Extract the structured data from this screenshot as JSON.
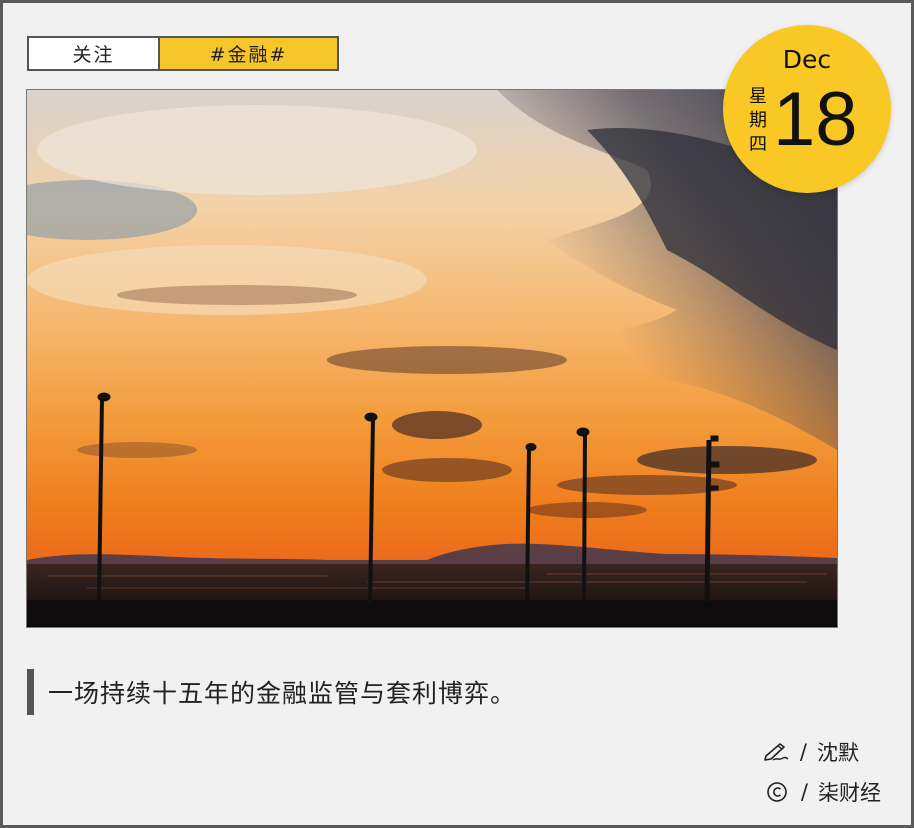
{
  "tags": {
    "follow": "关注",
    "topic": "#金融#"
  },
  "date": {
    "month": "Dec",
    "day": "18",
    "weekday_chars": [
      "星",
      "期",
      "四"
    ]
  },
  "photo": {
    "subject": "sunset-sea-streetlights"
  },
  "headline": "一场持续十五年的金融监管与套利博弈。",
  "credits": {
    "author_icon": "pen-writing-icon",
    "author_sep": "/",
    "author": "沈默",
    "source_icon": "copyright-icon",
    "source_sep": "/",
    "source": "柒财经"
  },
  "colors": {
    "accent": "#f7c62a",
    "badge": "#f9c824",
    "background": "#f1f1f1"
  }
}
